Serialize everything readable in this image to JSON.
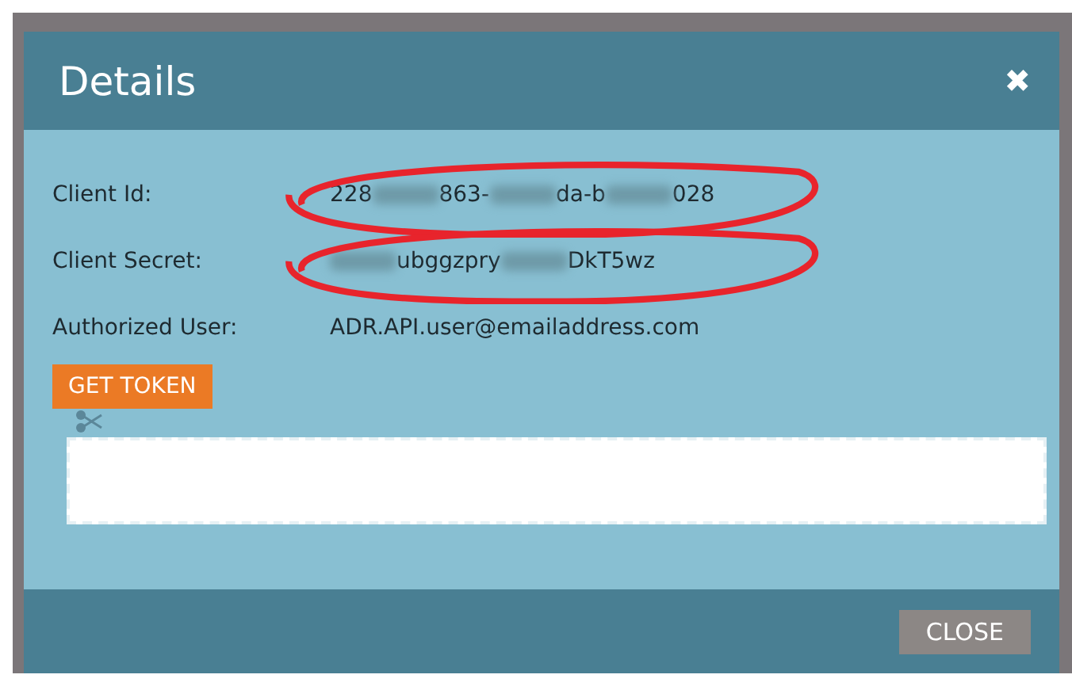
{
  "dialog": {
    "title": "Details",
    "close_icon": "✖"
  },
  "fields": [
    {
      "label": "Client Id:",
      "circled": true,
      "value": [
        {
          "kind": "text",
          "text": "228"
        },
        {
          "kind": "blurred"
        },
        {
          "kind": "text",
          "text": "863-"
        },
        {
          "kind": "blurred"
        },
        {
          "kind": "text",
          "text": "da-b"
        },
        {
          "kind": "blurred"
        },
        {
          "kind": "text",
          "text": "028"
        }
      ]
    },
    {
      "label": "Client Secret:",
      "circled": true,
      "value": [
        {
          "kind": "blurred"
        },
        {
          "kind": "text",
          "text": "ubggzpry"
        },
        {
          "kind": "blurred"
        },
        {
          "kind": "text",
          "text": "DkT5wz"
        }
      ]
    },
    {
      "label": "Authorized User:",
      "circled": false,
      "value": [
        {
          "kind": "text",
          "text": "ADR.API.user@emailaddress.com"
        }
      ]
    }
  ],
  "get_token_button": "GET TOKEN",
  "footer": {
    "close_button": "CLOSE"
  }
}
